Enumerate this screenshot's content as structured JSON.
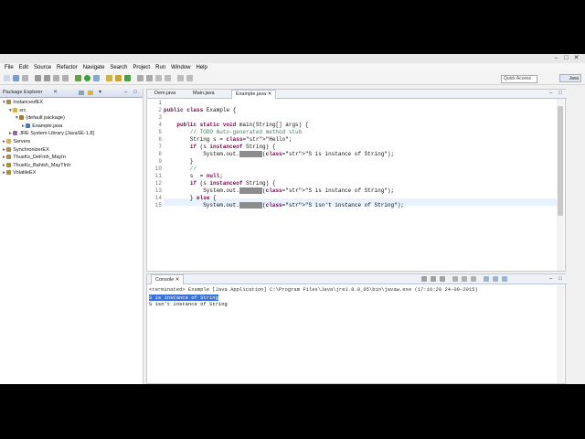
{
  "menu": [
    "File",
    "Edit",
    "Source",
    "Refactor",
    "Navigate",
    "Search",
    "Project",
    "Run",
    "Window",
    "Help"
  ],
  "toolbar": {
    "quick_access": "Quick Access",
    "perspective": "Java"
  },
  "package_explorer": {
    "title": "Package Explorer",
    "tree": [
      {
        "label": "InstanceofEX",
        "indent": 0,
        "arrow": "▾",
        "icon": "project"
      },
      {
        "label": "src",
        "indent": 1,
        "arrow": "▾",
        "icon": "folder"
      },
      {
        "label": "(default package)",
        "indent": 2,
        "arrow": "▾",
        "icon": "package"
      },
      {
        "label": "Example.java",
        "indent": 3,
        "arrow": "▸",
        "icon": "java"
      },
      {
        "label": "JRE System Library [JavaSE-1.8]",
        "indent": 1,
        "arrow": "▸",
        "icon": "library"
      },
      {
        "label": "Servers",
        "indent": 0,
        "arrow": "▸",
        "icon": "folder"
      },
      {
        "label": "SynchronizerEX",
        "indent": 0,
        "arrow": "▸",
        "icon": "project"
      },
      {
        "label": "ThusKs_DeFinh_MayIn",
        "indent": 0,
        "arrow": "▸",
        "icon": "project"
      },
      {
        "label": "ThusKs_Bahish_MayTInh",
        "indent": 0,
        "arrow": "▸",
        "icon": "project"
      },
      {
        "label": "VolatileEX",
        "indent": 0,
        "arrow": "▸",
        "icon": "project"
      }
    ]
  },
  "editor": {
    "tabs": [
      "Dem.java",
      "Main.java",
      "Example.java"
    ],
    "active_tab": 2,
    "lines": [
      {
        "n": "1",
        "text": ""
      },
      {
        "n": "2",
        "text": "public class Example {"
      },
      {
        "n": "3",
        "text": ""
      },
      {
        "n": "4",
        "text": "    public static void main(String[] args) {"
      },
      {
        "n": "5",
        "text": "        // TODO Auto-generated method stub"
      },
      {
        "n": "6",
        "text": "        String s = \"Hello\";"
      },
      {
        "n": "7",
        "text": "        if (s instanceof String) {"
      },
      {
        "n": "8",
        "text": "            System.out.println(\"S is instance of String\");"
      },
      {
        "n": "9",
        "text": "        }"
      },
      {
        "n": "10",
        "text": "        //"
      },
      {
        "n": "11",
        "text": "        s  = null;"
      },
      {
        "n": "12",
        "text": "        if (s instanceof String) {"
      },
      {
        "n": "13",
        "text": "            System.out.println(\"S is instance of String\");"
      },
      {
        "n": "14",
        "text": "        } else {"
      },
      {
        "n": "15",
        "text": "            System.out.println(\"S isn't instance of String\");"
      }
    ]
  },
  "console": {
    "title": "Console",
    "status": "<terminated> Example [Java Application] C:\\Program Files\\Java\\jre1.8.0_05\\bin\\javaw.exe (17:16:20 24-09-2015)",
    "lines": [
      "S is instance of String",
      "S isn't instance of String"
    ]
  }
}
